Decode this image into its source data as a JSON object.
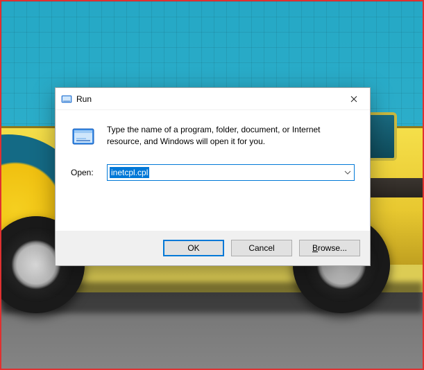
{
  "dialog": {
    "title": "Run",
    "description": "Type the name of a program, folder, document, or Internet resource, and Windows will open it for you.",
    "open_label": "Open:",
    "input_value": "inetcpl.cpl",
    "buttons": {
      "ok": "OK",
      "cancel": "Cancel",
      "browse": "Browse..."
    },
    "icons": {
      "title_icon": "run-icon",
      "body_icon": "run-icon",
      "close": "close-icon",
      "dropdown": "chevron-down-icon"
    }
  }
}
